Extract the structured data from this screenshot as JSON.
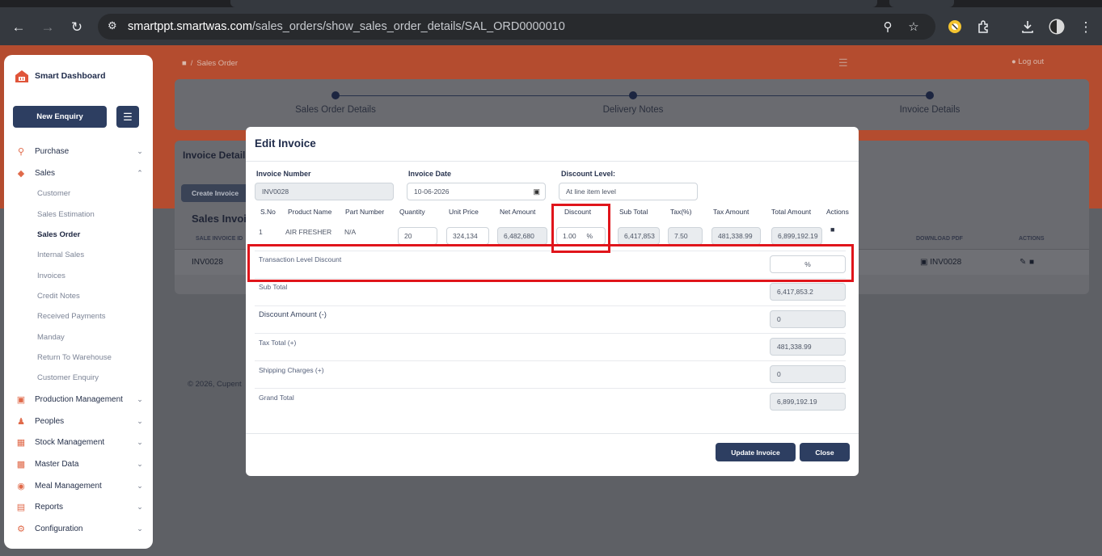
{
  "browser": {
    "url_host": "smartppt.smartwas.com",
    "url_path": "/sales_orders/show_sales_order_details/SAL_ORD0000010"
  },
  "sidebar": {
    "brand": "Smart Dashboard",
    "new_enquiry": "New Enquiry",
    "items": [
      {
        "label": "Purchase",
        "icon": "cart-icon"
      },
      {
        "label": "Sales",
        "icon": "sales-icon"
      },
      {
        "label": "Production Management",
        "icon": "factory-icon"
      },
      {
        "label": "Peoples",
        "icon": "people-icon"
      },
      {
        "label": "Stock Management",
        "icon": "stock-icon"
      },
      {
        "label": "Master Data",
        "icon": "master-data-icon"
      },
      {
        "label": "Meal Management",
        "icon": "meal-icon"
      },
      {
        "label": "Reports",
        "icon": "reports-icon"
      },
      {
        "label": "Configuration",
        "icon": "config-icon"
      }
    ],
    "sales_sub": [
      "Customer",
      "Sales Estimation",
      "Sales Order",
      "Internal Sales",
      "Invoices",
      "Credit Notes",
      "Received Payments",
      "Manday",
      "Return To Warehouse",
      "Customer Enquiry"
    ]
  },
  "page": {
    "breadcrumb": "Sales Order",
    "logout": "Log out",
    "steps": [
      "Sales Order Details",
      "Delivery Notes",
      "Invoice Details"
    ],
    "card_title": "Invoice Details",
    "create_invoice": "Create Invoice",
    "list_title": "Sales Invoi",
    "col_sale_invoice_id": "SALE INVOICE ID",
    "col_download_pdf": "DOWNLOAD PDF",
    "col_actions": "ACTIONS",
    "row_id": "INV0028",
    "row_pdf": "INV0028",
    "footer": "© 2026, Cupent"
  },
  "modal": {
    "title": "Edit Invoice",
    "invoice_number_label": "Invoice Number",
    "invoice_number": "INV0028",
    "invoice_date_label": "Invoice Date",
    "invoice_date": "10-06-2026",
    "discount_level_label": "Discount Level:",
    "discount_level": "At line item level",
    "columns": [
      "S.No",
      "Product Name",
      "Part Number",
      "Quantity",
      "Unit Price",
      "Net Amount",
      "Discount",
      "Sub Total",
      "Tax(%)",
      "Tax Amount",
      "Total Amount",
      "Actions"
    ],
    "row": {
      "sno": "1",
      "product": "AIR FRESHER",
      "part": "N/A",
      "quantity": "20",
      "unit_price": "324,134",
      "net_amount": "6,482,680",
      "discount": "1.00",
      "discount_unit": "%",
      "sub_total": "6,417,853",
      "tax_pct": "7.50",
      "tax_amount": "481,338.99",
      "total_amount": "6,899,192.19"
    },
    "summary": {
      "transaction_discount_label": "Transaction Level Discount",
      "transaction_discount_unit": "%",
      "sub_total_label": "Sub Total",
      "sub_total": "6,417,853.2",
      "discount_amount_label": "Discount Amount (-)",
      "discount_amount": "0",
      "tax_total_label": "Tax Total (+)",
      "tax_total": "481,338.99",
      "shipping_label": "Shipping Charges (+)",
      "shipping": "0",
      "grand_total_label": "Grand Total",
      "grand_total": "6,899,192.19"
    },
    "update_button": "Update Invoice",
    "close_button": "Close"
  },
  "colors": {
    "accent_orange": "#e8663f",
    "navy": "#2d3e61",
    "highlight_red": "#e0151b"
  }
}
